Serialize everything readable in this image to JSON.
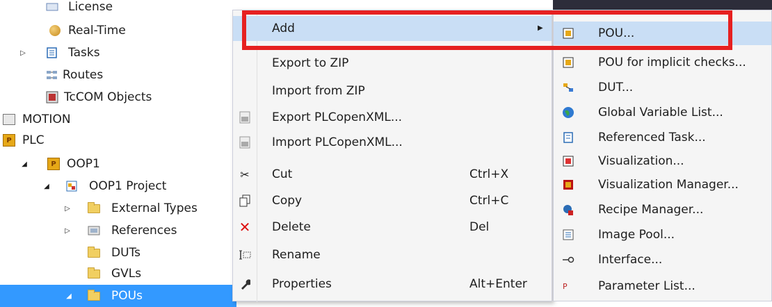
{
  "tree": {
    "items": [
      {
        "label": "License",
        "expander": "",
        "icon": "license-icon"
      },
      {
        "label": "Real-Time",
        "expander": "",
        "icon": "realtime-icon"
      },
      {
        "label": "Tasks",
        "expander": "▷",
        "icon": "tasks-icon"
      },
      {
        "label": "Routes",
        "expander": "",
        "icon": "routes-icon"
      },
      {
        "label": "TcCOM Objects",
        "expander": "",
        "icon": "tccom-icon"
      },
      {
        "label": "MOTION",
        "expander": "",
        "icon": "motion-icon"
      },
      {
        "label": "PLC",
        "expander": "",
        "icon": "plc-icon"
      },
      {
        "label": "OOP1",
        "expander": "◢",
        "icon": "plc-project-icon"
      },
      {
        "label": "OOP1 Project",
        "expander": "◢",
        "icon": "project-icon"
      },
      {
        "label": "External Types",
        "expander": "▷",
        "icon": "folder-icon"
      },
      {
        "label": "References",
        "expander": "▷",
        "icon": "references-icon"
      },
      {
        "label": "DUTs",
        "expander": "",
        "icon": "folder-icon"
      },
      {
        "label": "GVLs",
        "expander": "",
        "icon": "folder-icon"
      },
      {
        "label": "POUs",
        "expander": "◢",
        "icon": "folder-open-icon"
      }
    ]
  },
  "context_menu": {
    "items": [
      {
        "label": "Add",
        "shortcut": "",
        "icon": "",
        "submenu": "▶"
      },
      {
        "label": "Export to ZIP",
        "shortcut": "",
        "icon": ""
      },
      {
        "label": "Import from ZIP",
        "shortcut": "",
        "icon": ""
      },
      {
        "label": "Export PLCopenXML...",
        "shortcut": "",
        "icon": "export-xml-icon"
      },
      {
        "label": "Import PLCopenXML...",
        "shortcut": "",
        "icon": "import-xml-icon"
      },
      {
        "label": "Cut",
        "shortcut": "Ctrl+X",
        "icon": "cut-icon"
      },
      {
        "label": "Copy",
        "shortcut": "Ctrl+C",
        "icon": "copy-icon"
      },
      {
        "label": "Delete",
        "shortcut": "Del",
        "icon": "delete-icon"
      },
      {
        "label": "Rename",
        "shortcut": "",
        "icon": "rename-icon"
      },
      {
        "label": "Properties",
        "shortcut": "Alt+Enter",
        "icon": "properties-icon"
      }
    ]
  },
  "add_submenu": {
    "items": [
      {
        "label": "POU...",
        "icon": "pou-icon"
      },
      {
        "label": "POU for implicit checks...",
        "icon": "pou-checks-icon"
      },
      {
        "label": "DUT...",
        "icon": "dut-icon"
      },
      {
        "label": "Global Variable List...",
        "icon": "gvl-icon"
      },
      {
        "label": "Referenced Task...",
        "icon": "task-icon"
      },
      {
        "label": "Visualization...",
        "icon": "visualization-icon"
      },
      {
        "label": "Visualization Manager...",
        "icon": "vis-manager-icon"
      },
      {
        "label": "Recipe Manager...",
        "icon": "recipe-icon"
      },
      {
        "label": "Image Pool...",
        "icon": "image-pool-icon"
      },
      {
        "label": "Interface...",
        "icon": "interface-icon"
      },
      {
        "label": "Parameter List...",
        "icon": "parameter-icon"
      }
    ]
  },
  "colors": {
    "selection": "#3399ff",
    "menu_hover": "#c9def5",
    "highlight_border": "#e62020"
  }
}
